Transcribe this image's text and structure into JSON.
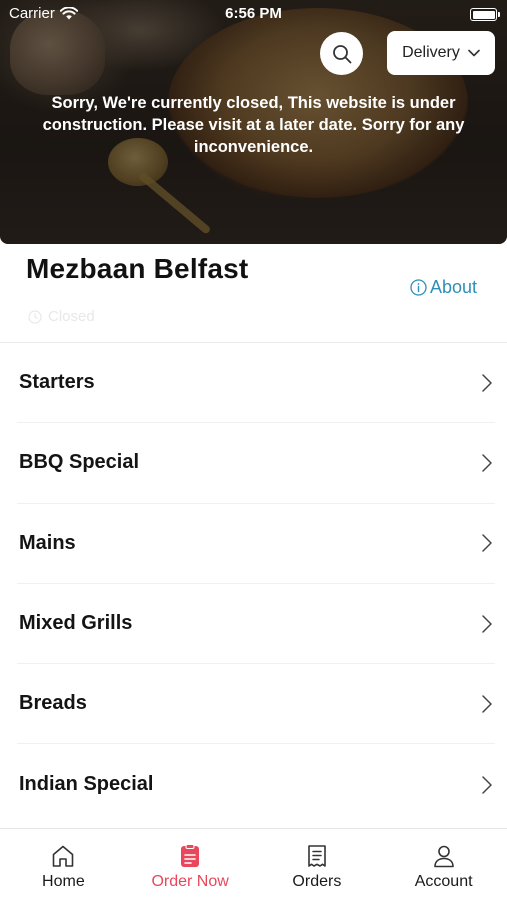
{
  "status_bar": {
    "carrier": "Carrier",
    "time": "6:56 PM"
  },
  "hero": {
    "closed_message": "Sorry, We're currently closed, This website is under construction. Please visit at a later date. Sorry for any inconvenience.",
    "delivery_label": "Delivery",
    "search_icon": "search-icon"
  },
  "restaurant": {
    "name": "Mezbaan Belfast",
    "about_label": "About",
    "status_label": "Closed"
  },
  "categories": [
    {
      "label": "Starters"
    },
    {
      "label": "BBQ Special"
    },
    {
      "label": "Mains"
    },
    {
      "label": "Mixed Grills"
    },
    {
      "label": "Breads"
    },
    {
      "label": "Indian Special"
    }
  ],
  "tabbar": {
    "items": [
      {
        "label": "Home",
        "icon": "home-icon"
      },
      {
        "label": "Order Now",
        "icon": "order-icon",
        "active": true
      },
      {
        "label": "Orders",
        "icon": "receipt-icon"
      },
      {
        "label": "Account",
        "icon": "person-icon"
      }
    ]
  },
  "colors": {
    "accent": "#e8475c",
    "link": "#2f8fb8"
  }
}
